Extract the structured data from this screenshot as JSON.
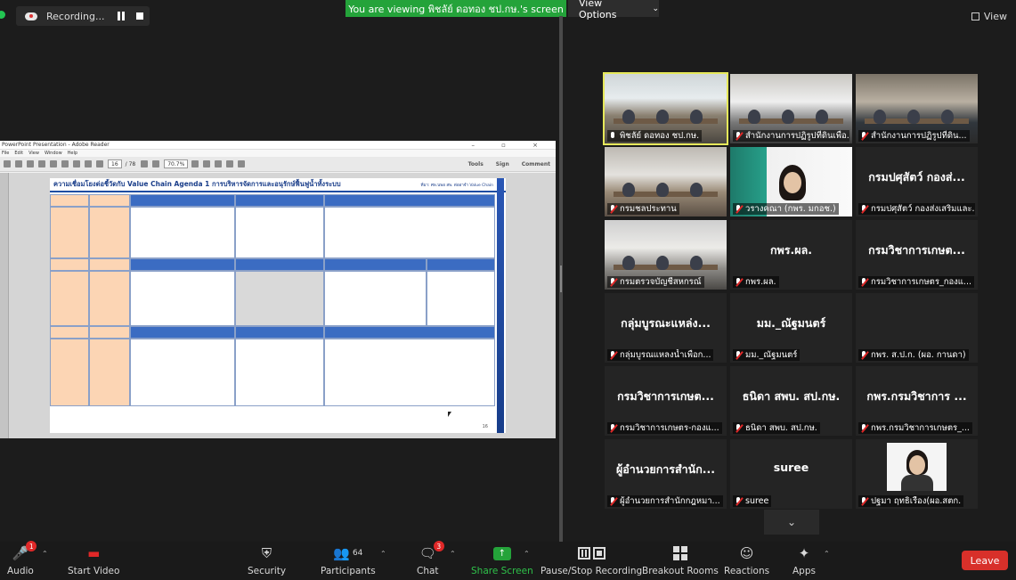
{
  "top": {
    "recording_label": "Recording...",
    "viewing_banner": "You are viewing พิชลัย์ ดอทอง ชป.กษ.'s screen",
    "view_options": "View Options",
    "view_button": "View"
  },
  "shared_screen": {
    "window_title": "PowerPoint Presentation - Adobe Reader",
    "menu": [
      "File",
      "Edit",
      "View",
      "Window",
      "Help"
    ],
    "page_field": "16",
    "page_total": "/ 78",
    "zoom": "70.7%",
    "toolbar_right": [
      "Tools",
      "Sign",
      "Comment"
    ],
    "slide_title": "ความเชื่อมโยงต่อชี้วัดกับ Value Chain Agenda 1 การบริหารจัดการและอนุรักษ์ฟื้นฟูน้ำทั้งระบบ",
    "slide_note": "ที่มา: ศพ.นพอ สพ. ต่ออาจำ Value Chain",
    "page_number": "16"
  },
  "participants": [
    {
      "name": "พิชลัย์ ดอทอง ชป.กษ.",
      "big": "",
      "muted": false,
      "video": "room1",
      "active": true
    },
    {
      "name": "สำนักงานการปฏิรูปที่ดินเพื่อ...",
      "big": "",
      "muted": true,
      "video": "room2",
      "active": false
    },
    {
      "name": "สำนักงานการปฏิรูปที่ดิน...",
      "big": "",
      "muted": true,
      "video": "room3",
      "active": false
    },
    {
      "name": "กรมชลประทาน",
      "big": "",
      "muted": true,
      "video": "room4",
      "active": false
    },
    {
      "name": "วรางคณา (กพร. มกอช.)",
      "big": "",
      "muted": true,
      "video": "room5",
      "active": false
    },
    {
      "name": "กรมปศุสัตว์ กองส่งเสริมและ...",
      "big": "กรมปศุสัตว์ กองส่...",
      "muted": true,
      "video": "",
      "active": false
    },
    {
      "name": "กรมตรวจบัญชีสหกรณ์",
      "big": "",
      "muted": true,
      "video": "room6",
      "active": false
    },
    {
      "name": "กพร.ผล.",
      "big": "กพร.ผล.",
      "muted": true,
      "video": "",
      "active": false
    },
    {
      "name": "กรมวิชาการเกษตร_กองแ...",
      "big": "กรมวิชาการเกษต...",
      "muted": true,
      "video": "",
      "active": false
    },
    {
      "name": "กลุ่มบูรณแหลงน้ำเพื่อก...",
      "big": "กลุ่มบูรณะแหล่ง...",
      "muted": true,
      "video": "",
      "active": false
    },
    {
      "name": "มม._ณัฐมนตร์",
      "big": "มม._ณัฐมนตร์",
      "muted": true,
      "video": "",
      "active": false
    },
    {
      "name": "กพร. ส.ป.ก. (ผอ. กานดา)",
      "big": "",
      "muted": true,
      "video": "",
      "active": false
    },
    {
      "name": "กรมวิชาการเกษตร-กองแ...",
      "big": "กรมวิชาการเกษต...",
      "muted": true,
      "video": "",
      "active": false
    },
    {
      "name": "ธนิดา สพบ. สป.กษ.",
      "big": "ธนิดา สพบ. สป.กษ.",
      "muted": true,
      "video": "",
      "active": false
    },
    {
      "name": "กพร.กรมวิชาการเกษตร_...",
      "big": "กพร.กรมวิชาการ ...",
      "muted": true,
      "video": "",
      "active": false
    },
    {
      "name": "ผู้อำนวยการสำนักกฎหมา...",
      "big": "ผู้อำนวยการสำนัก...",
      "muted": true,
      "video": "",
      "active": false
    },
    {
      "name": "suree",
      "big": "suree",
      "muted": true,
      "video": "",
      "active": false
    },
    {
      "name": "ปฐมา ฤทธิเรือง(ผอ.สตก.",
      "big": "",
      "muted": true,
      "video": "avatar",
      "active": false
    }
  ],
  "toolbar": {
    "audio": "Audio",
    "audio_badge": "1",
    "start_video": "Start Video",
    "security": "Security",
    "participants": "Participants",
    "participants_count": "64",
    "chat": "Chat",
    "chat_badge": "3",
    "share_screen": "Share Screen",
    "pause_stop": "Pause/Stop Recording",
    "breakout": "Breakout Rooms",
    "reactions": "Reactions",
    "apps": "Apps",
    "leave": "Leave"
  },
  "colors": {
    "banner_green": "#24a33a",
    "leave_red": "#d8302a",
    "active_speaker": "#e6e85a"
  }
}
